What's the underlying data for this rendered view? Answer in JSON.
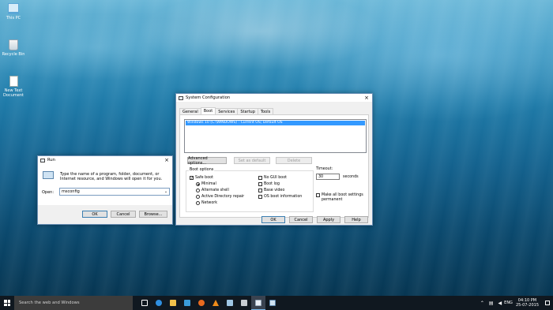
{
  "desktop": {
    "icons": [
      {
        "label": "This PC",
        "icon": "computer-icon"
      },
      {
        "label": "Recycle Bin",
        "icon": "recycle-bin-icon"
      },
      {
        "label": "New Text Document",
        "icon": "text-document-icon"
      }
    ]
  },
  "run_dialog": {
    "title": "Run",
    "description": "Type the name of a program, folder, document, or Internet resource, and Windows will open it for you.",
    "open_label": "Open:",
    "open_value": "msconfig",
    "ok_label": "OK",
    "cancel_label": "Cancel",
    "browse_label": "Browse..."
  },
  "msconfig": {
    "title": "System Configuration",
    "tabs": [
      "General",
      "Boot",
      "Services",
      "Startup",
      "Tools"
    ],
    "active_tab": "Boot",
    "os_entries": [
      "Windows 10 (C:\\WINDOWS) : Current OS; Default OS"
    ],
    "advanced_options_label": "Advanced options...",
    "set_default_label": "Set as default",
    "delete_label": "Delete",
    "boot_options_label": "Boot options",
    "safe_boot_label": "Safe boot",
    "safe_boot_checked": true,
    "radio_options": [
      {
        "label": "Minimal",
        "selected": true
      },
      {
        "label": "Alternate shell",
        "selected": false
      },
      {
        "label": "Active Directory repair",
        "selected": false
      },
      {
        "label": "Network",
        "selected": false
      }
    ],
    "right_checkboxes": [
      {
        "label": "No GUI boot",
        "checked": false
      },
      {
        "label": "Boot log",
        "checked": false
      },
      {
        "label": "Base video",
        "checked": false
      },
      {
        "label": "OS boot information",
        "checked": false
      }
    ],
    "timeout_label": "Timeout:",
    "timeout_value": "30",
    "timeout_unit": "seconds",
    "make_permanent_label_1": "Make all boot settings",
    "make_permanent_label_2": "permanent",
    "ok_label": "OK",
    "cancel_label": "Cancel",
    "apply_label": "Apply",
    "help_label": "Help"
  },
  "taskbar": {
    "search_placeholder": "Search the web and Windows",
    "language": "ENG",
    "time": "04:10 PM",
    "date": "25-07-2015"
  }
}
